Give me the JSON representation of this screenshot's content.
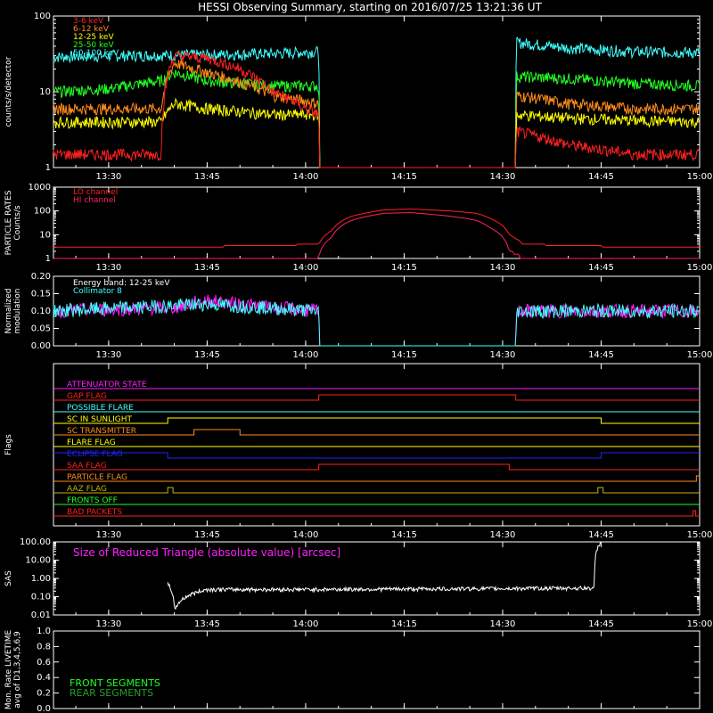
{
  "title": "HESSI Observing Summary, starting on 2016/07/25 13:21:36 UT",
  "colors": {
    "red": "#ff2020",
    "orange": "#ff8c1a",
    "yellow": "#ffff00",
    "green": "#22ff22",
    "cyan": "#40ffff",
    "magenta": "#ff20ff",
    "blue": "#2222ff",
    "olive": "#c8b400",
    "white": "#ffffff",
    "dkgreen": "#2a9a2a"
  },
  "x_ticks": [
    "13:30",
    "13:45",
    "14:00",
    "14:15",
    "14:30",
    "14:45",
    "15:00"
  ],
  "x_tick_minutes": [
    30,
    45,
    60,
    75,
    90,
    105,
    120
  ],
  "chart_data": [
    {
      "id": "counts",
      "type": "line",
      "ylabel": "counts/s/detector",
      "yscale": "log",
      "ylim": [
        1,
        100
      ],
      "y_ticks": [
        "1",
        "10",
        "100"
      ],
      "legend": [
        {
          "label": "3-6 keV",
          "color": "#ff2020"
        },
        {
          "label": "6-12 keV",
          "color": "#ff8c1a"
        },
        {
          "label": "12-25 keV",
          "color": "#ffff00"
        },
        {
          "label": "25-50 keV",
          "color": "#22ff22"
        },
        {
          "label": "50-100 keV",
          "color": "#40ffff"
        }
      ],
      "series": [
        {
          "name": "50-100 keV",
          "color": "#40ffff",
          "points": [
            [
              21.6,
              29
            ],
            [
              30,
              30
            ],
            [
              45,
              31
            ],
            [
              55,
              32
            ],
            [
              62,
              34
            ],
            [
              62.1,
              1
            ],
            [
              92,
              1
            ],
            [
              92.1,
              45
            ],
            [
              100,
              38
            ],
            [
              110,
              34
            ],
            [
              120,
              33
            ]
          ]
        },
        {
          "name": "25-50 keV",
          "color": "#22ff22",
          "points": [
            [
              21.6,
              10
            ],
            [
              30,
              11
            ],
            [
              38,
              14
            ],
            [
              40,
              18
            ],
            [
              45,
              14
            ],
            [
              55,
              12
            ],
            [
              62,
              12
            ],
            [
              62.1,
              1
            ],
            [
              92,
              1
            ],
            [
              92.1,
              16
            ],
            [
              100,
              15
            ],
            [
              110,
              13
            ],
            [
              120,
              12
            ]
          ]
        },
        {
          "name": "6-12 keV",
          "color": "#ff8c1a",
          "points": [
            [
              21.6,
              6
            ],
            [
              38,
              6
            ],
            [
              40,
              24
            ],
            [
              45,
              18
            ],
            [
              55,
              9
            ],
            [
              62,
              7
            ],
            [
              62.1,
              1
            ],
            [
              92,
              1
            ],
            [
              92.1,
              9
            ],
            [
              100,
              7
            ],
            [
              110,
              6
            ],
            [
              120,
              6
            ]
          ]
        },
        {
          "name": "12-25 keV",
          "color": "#ffff00",
          "points": [
            [
              21.6,
              4
            ],
            [
              38,
              4
            ],
            [
              40,
              7
            ],
            [
              45,
              6
            ],
            [
              55,
              5
            ],
            [
              62,
              5
            ],
            [
              62.1,
              1
            ],
            [
              92,
              1
            ],
            [
              92.1,
              5
            ],
            [
              100,
              4.5
            ],
            [
              110,
              4.2
            ],
            [
              120,
              4
            ]
          ]
        },
        {
          "name": "3-6 keV",
          "color": "#ff2020",
          "points": [
            [
              21.6,
              1.5
            ],
            [
              38,
              1.5
            ],
            [
              40,
              30
            ],
            [
              45,
              28
            ],
            [
              50,
              20
            ],
            [
              55,
              10
            ],
            [
              60,
              6
            ],
            [
              62,
              5
            ],
            [
              62.1,
              1
            ],
            [
              92,
              1
            ],
            [
              92.1,
              3
            ],
            [
              100,
              2
            ],
            [
              110,
              1.5
            ],
            [
              120,
              1.5
            ]
          ]
        }
      ]
    },
    {
      "id": "particle",
      "type": "line",
      "ylabel": "PARTICLE RATES Counts/s",
      "yscale": "log",
      "ylim": [
        1,
        1000
      ],
      "y_ticks": [
        "1",
        "10",
        "100",
        "1000"
      ],
      "legend": [
        {
          "label": "LO channel",
          "color": "#ff2020"
        },
        {
          "label": "HI channel",
          "color": "#ff2060"
        }
      ],
      "series": [
        {
          "name": "LO channel",
          "color": "#ff2020",
          "points": [
            [
              21.6,
              3
            ],
            [
              40,
              3
            ],
            [
              55,
              3.5
            ],
            [
              62,
              4
            ],
            [
              64,
              15
            ],
            [
              67,
              60
            ],
            [
              72,
              110
            ],
            [
              76,
              120
            ],
            [
              82,
              100
            ],
            [
              86,
              80
            ],
            [
              88,
              50
            ],
            [
              91,
              10
            ],
            [
              93,
              4
            ],
            [
              100,
              3.5
            ],
            [
              110,
              3
            ],
            [
              120,
              3
            ]
          ]
        },
        {
          "name": "HI channel",
          "color": "#ff2060",
          "points": [
            [
              21.6,
              1
            ],
            [
              62,
              1
            ],
            [
              64,
              8
            ],
            [
              67,
              40
            ],
            [
              72,
              80
            ],
            [
              76,
              85
            ],
            [
              82,
              60
            ],
            [
              86,
              40
            ],
            [
              88,
              20
            ],
            [
              91,
              2
            ],
            [
              93,
              1
            ],
            [
              120,
              1
            ]
          ]
        }
      ]
    },
    {
      "id": "modulation",
      "type": "line",
      "ylabel": "Normalized modulation",
      "ylim": [
        0,
        0.2
      ],
      "y_ticks": [
        "0.00",
        "0.05",
        "0.10",
        "0.15",
        "0.20"
      ],
      "legend": [
        {
          "label": "Energy band: 12-25 keV",
          "color": "#ffffff"
        },
        {
          "label": "Collimator 8",
          "color": "#40ffff"
        }
      ],
      "series": [
        {
          "name": "Energy band: 12-25 keV",
          "color": "#ff20ff",
          "points": [
            [
              21.6,
              0.1
            ],
            [
              40,
              0.11
            ],
            [
              45,
              0.13
            ],
            [
              55,
              0.11
            ],
            [
              62,
              0.1
            ],
            [
              62.1,
              0
            ],
            [
              92,
              0
            ],
            [
              92.1,
              0.1
            ],
            [
              120,
              0.1
            ]
          ]
        },
        {
          "name": "Collimator 8",
          "color": "#40ffff",
          "points": [
            [
              21.6,
              0.1
            ],
            [
              45,
              0.12
            ],
            [
              62,
              0.1
            ],
            [
              62.1,
              0
            ],
            [
              92,
              0
            ],
            [
              92.1,
              0.1
            ],
            [
              120,
              0.1
            ]
          ]
        }
      ]
    },
    {
      "id": "flags",
      "type": "line",
      "ylabel": "Flags",
      "flags": [
        {
          "label": "ATTENUATOR STATE",
          "color": "#ff20ff",
          "steps": [
            [
              21.6,
              0
            ],
            [
              120,
              0
            ]
          ]
        },
        {
          "label": "GAP FLAG",
          "color": "#ff2020",
          "steps": [
            [
              21.6,
              0
            ],
            [
              62,
              1
            ],
            [
              92,
              0
            ],
            [
              120,
              0
            ]
          ]
        },
        {
          "label": "POSSIBLE FLARE",
          "color": "#40ffff",
          "steps": [
            [
              21.6,
              0
            ],
            [
              120,
              0
            ]
          ]
        },
        {
          "label": "SC IN SUNLIGHT",
          "color": "#ffff00",
          "steps": [
            [
              21.6,
              0
            ],
            [
              39,
              1
            ],
            [
              105,
              0
            ],
            [
              120,
              0
            ]
          ]
        },
        {
          "label": "SC TRANSMITTER",
          "color": "#ff8c1a",
          "steps": [
            [
              21.6,
              0
            ],
            [
              43,
              1
            ],
            [
              50,
              0
            ],
            [
              120,
              0
            ]
          ]
        },
        {
          "label": "FLARE FLAG",
          "color": "#ffff00",
          "steps": [
            [
              21.6,
              0
            ],
            [
              120,
              0
            ]
          ]
        },
        {
          "label": "ECLIPSE FLAG",
          "color": "#2222ff",
          "steps": [
            [
              21.6,
              1
            ],
            [
              39,
              0
            ],
            [
              105,
              1
            ],
            [
              120,
              1
            ]
          ]
        },
        {
          "label": "SAA FLAG",
          "color": "#ff2020",
          "steps": [
            [
              21.6,
              0
            ],
            [
              62,
              1
            ],
            [
              91,
              0
            ],
            [
              120,
              0
            ]
          ]
        },
        {
          "label": "PARTICLE FLAG",
          "color": "#ff8c1a",
          "steps": [
            [
              21.6,
              0
            ],
            [
              119.5,
              1
            ],
            [
              120,
              1
            ]
          ]
        },
        {
          "label": "AAZ FLAG",
          "color": "#c8b400",
          "steps": [
            [
              21.6,
              0
            ],
            [
              39,
              1
            ],
            [
              39.8,
              0
            ],
            [
              104.5,
              1
            ],
            [
              105.3,
              0
            ],
            [
              120,
              0
            ]
          ]
        },
        {
          "label": "FRONTS OFF",
          "color": "#22ff22",
          "steps": [
            [
              21.6,
              0
            ],
            [
              120,
              0
            ]
          ]
        },
        {
          "label": "BAD PACKETS",
          "color": "#ff2020",
          "steps": [
            [
              21.6,
              0
            ],
            [
              119,
              1
            ],
            [
              119.4,
              0
            ],
            [
              120,
              0
            ]
          ]
        }
      ]
    },
    {
      "id": "sas",
      "type": "line",
      "ylabel": "SAS",
      "yscale": "log",
      "ylim": [
        0.01,
        100
      ],
      "y_ticks": [
        "0.01",
        "0.10",
        "1.00",
        "10.00",
        "100.00"
      ],
      "annotation": "Size of Reduced Triangle (absolute value) [arcsec]",
      "series": [
        {
          "name": "",
          "color": "#ffffff",
          "points": [
            [
              39,
              0.5
            ],
            [
              40,
              0.015
            ],
            [
              45,
              0.25
            ],
            [
              60,
              0.25
            ],
            [
              90,
              0.28
            ],
            [
              104,
              0.3
            ],
            [
              105,
              100
            ]
          ]
        }
      ]
    },
    {
      "id": "livetime",
      "type": "line",
      "ylabel": "Mon. Rate LIVETIME avg of D1,3,4,5,6,9",
      "ylim": [
        0,
        1.0
      ],
      "y_ticks": [
        "0.0",
        "0.2",
        "0.4",
        "0.6",
        "0.8",
        "1.0"
      ],
      "legend": [
        {
          "label": "FRONT SEGMENTS",
          "color": "#22ff22"
        },
        {
          "label": "REAR SEGMENTS",
          "color": "#2a9a2a"
        }
      ],
      "series": []
    }
  ]
}
